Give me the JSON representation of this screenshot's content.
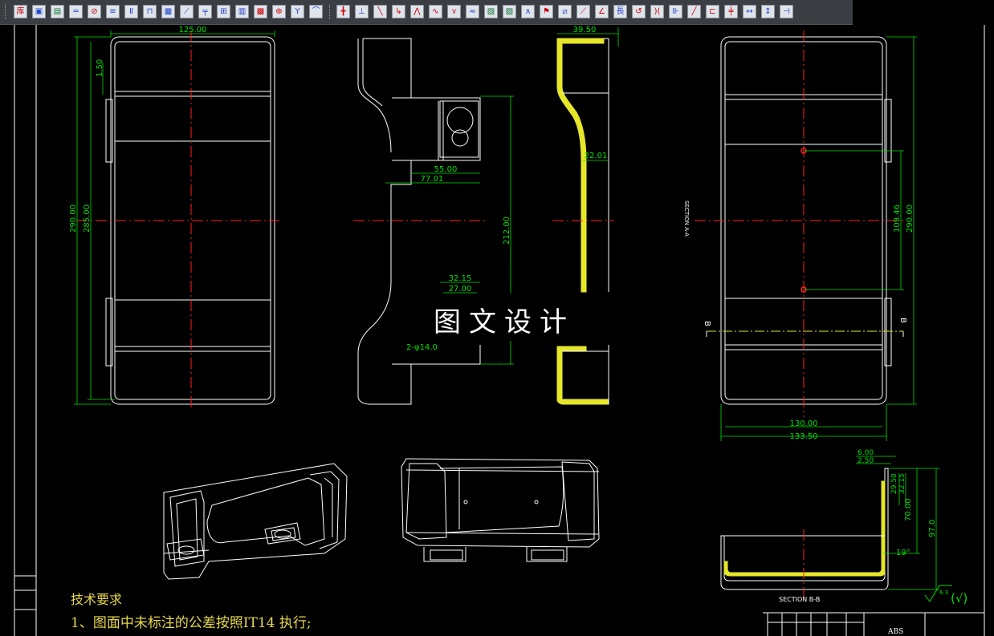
{
  "toolbar": {
    "first_icon_label": "库",
    "tool_icons": [
      "library-icon",
      "insert-block-icon",
      "frame-icon",
      "hatch-line-icon",
      "circle-mark-icon",
      "stack-icon",
      "column-icon",
      "bracket-icon",
      "matrix-icon",
      "diag-icon",
      "beam-icon",
      "window-icon",
      "panel-icon",
      "grid-icon",
      "target-icon",
      "funnel-icon",
      "bevel-icon",
      "cross-icon",
      "down-arrow-icon",
      "slash-icon",
      "hook-icon",
      "tower-icon",
      "wave-icon",
      "zigzag-icon",
      "bar-icon",
      "layer-icon",
      "peak-icon",
      "flag-icon",
      "hatch-icon",
      "line-icon",
      "angle-icon",
      "long-icon",
      "curve-icon",
      "arc-icon",
      "multi-icon",
      "split-icon",
      "box-icon",
      "cut-icon",
      "dim-icon",
      "endmark-icon"
    ],
    "long_label": "長"
  },
  "drawing": {
    "front_view": {
      "width_dim": "125.00",
      "dim_150": "1.50",
      "height_290": "290.00",
      "height_285": "285.00"
    },
    "side_view": {
      "dim_55": "55.00",
      "dim_77": "77.01",
      "dim_212": "212.00",
      "dim_3215": "32.15",
      "dim_27": "27.00",
      "note": "2-φ14.0"
    },
    "section_a": {
      "dim_395": "39.50",
      "dim_2201": "22.01"
    },
    "back_view": {
      "label": "SECTION A-A",
      "dim_10946": "109.46",
      "dim_290": "290.00",
      "dim_130": "130.00",
      "dim_1335": "133.50",
      "b_left": "B",
      "b_right": "B"
    },
    "section_b": {
      "label": "SECTION B-B",
      "dim_6": "6.00",
      "dim_25": "2.50",
      "dim_2950": "29.50",
      "dim_3215": "32.15",
      "dim_70": "70.00",
      "dim_97": "97.0",
      "angle": "19°",
      "roughness": "6.3",
      "roughness_paren": "(√)"
    },
    "title_block": {
      "material": "ABS"
    }
  },
  "watermark": "图文设计",
  "requirements": {
    "title": "技术要求",
    "item1": "1、图面中未标注的公差按照IT14 执行;"
  },
  "colors": {
    "dim": "#00e000",
    "center": "#ff2020",
    "outline": "#ffffff",
    "section_fill": "#e6e62a",
    "text_yellow": "#e8d84a"
  }
}
